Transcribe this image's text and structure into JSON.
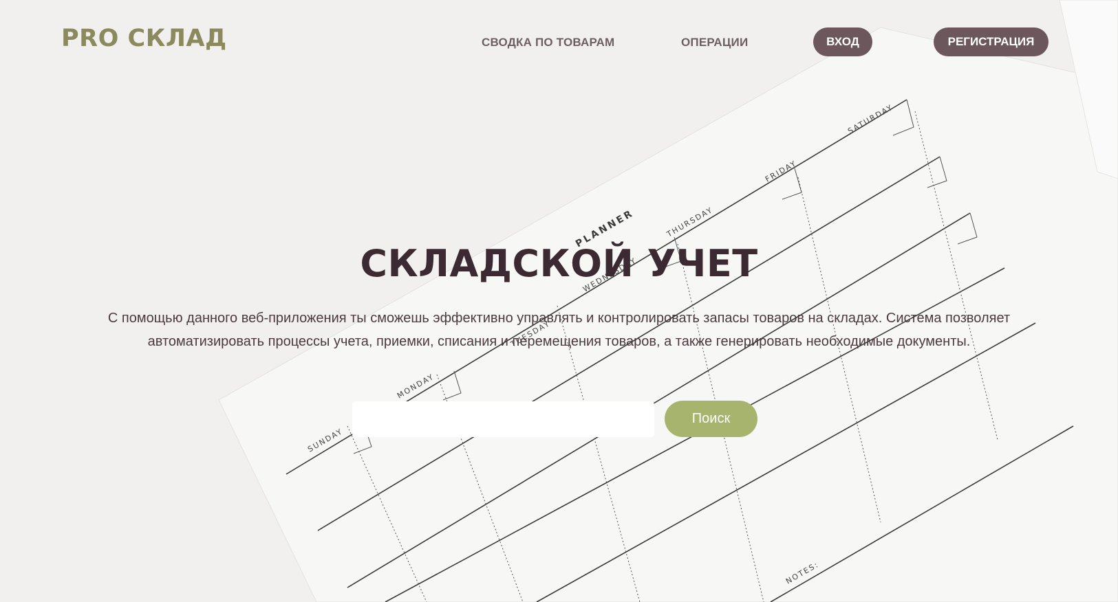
{
  "brand": {
    "logo_text": "PRO СКЛАД",
    "logo_color": "#8a8a5e"
  },
  "nav": {
    "summary_label": "СВОДКА ПО ТОВАРАМ",
    "operations_label": "ОПЕРАЦИИ",
    "login_label": "ВХОД",
    "register_label": "РЕГИСТРАЦИЯ",
    "button_color": "#6b575c"
  },
  "hero": {
    "title": "СКЛАДСКОЙ УЧЕТ",
    "description": "С помощью данного веб-приложения ты сможешь эффективно управлять и контролировать запасы товаров на складах. Система позволяет автоматизировать процессы учета, приемки, списания и перемещения товаров, а также генерировать необходимые документы."
  },
  "search": {
    "value": "",
    "placeholder": "",
    "button_label": "Поиск",
    "button_color": "#a7b46e"
  },
  "background": {
    "planner_title": "PLANNER",
    "days": [
      "SUNDAY",
      "MONDAY",
      "TUESDAY",
      "WEDNESDAY",
      "THURSDAY",
      "FRIDAY",
      "SATURDAY"
    ],
    "notes_label": "NOTES:"
  }
}
